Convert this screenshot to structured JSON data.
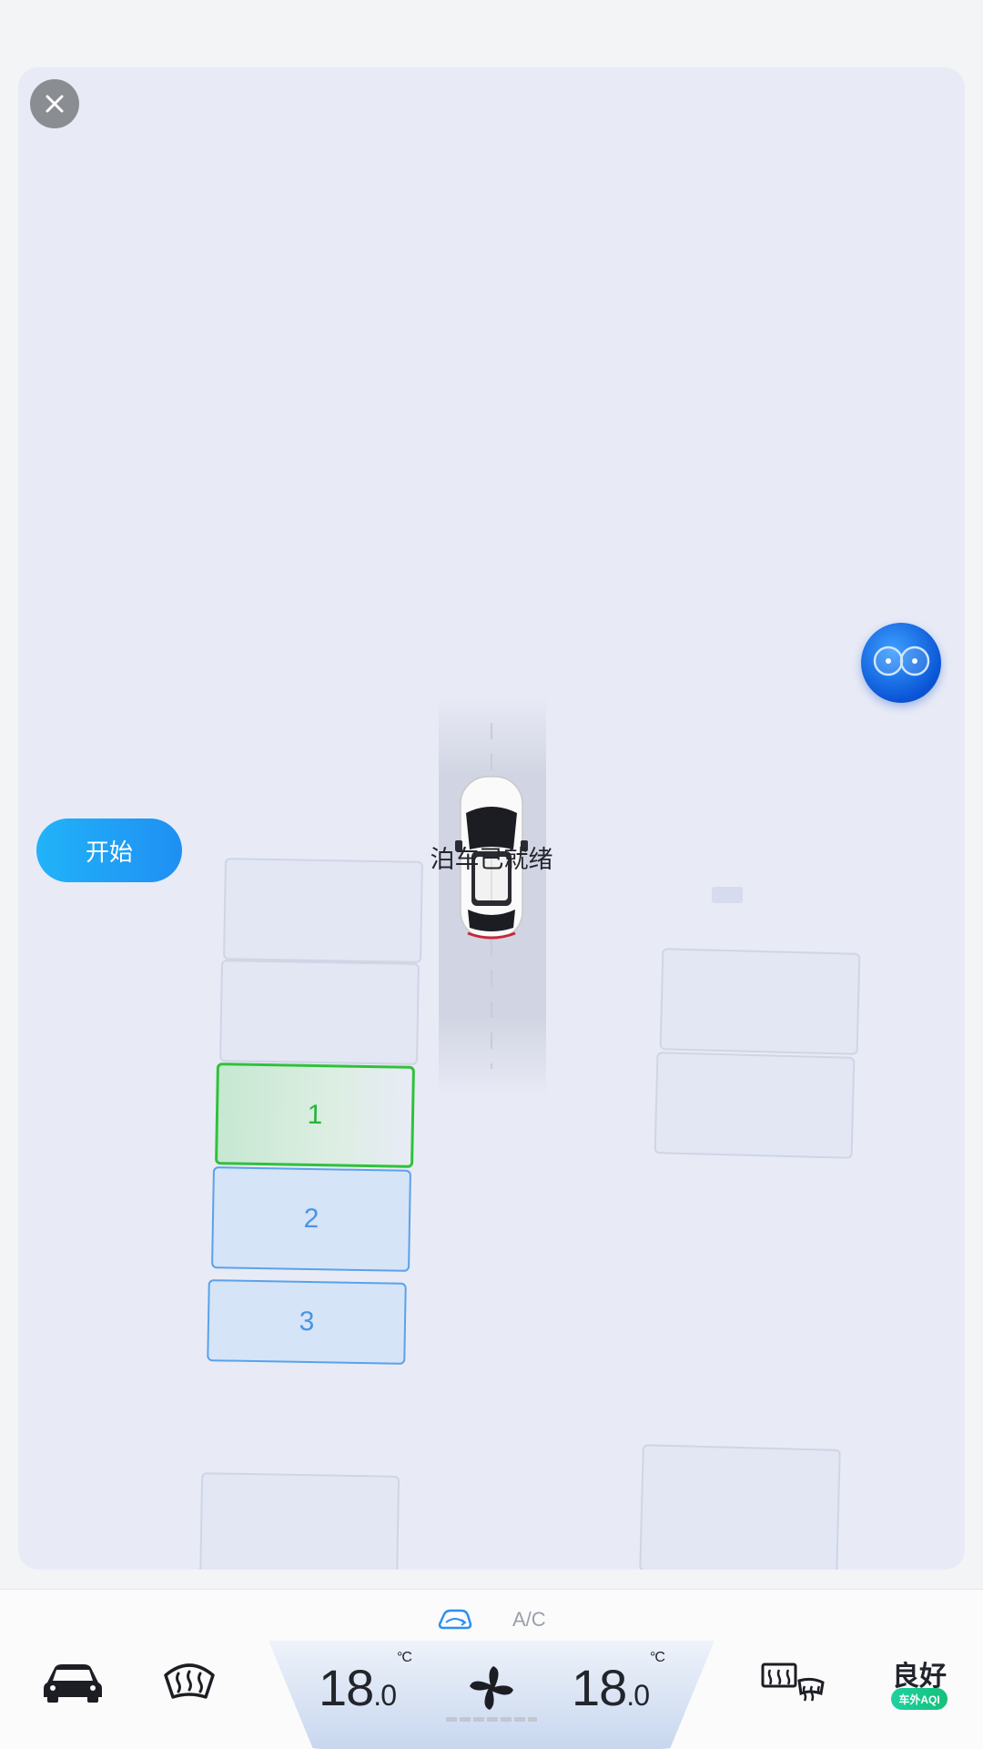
{
  "parking": {
    "status_text": "泊车已就绪",
    "start_label": "开始",
    "slots": [
      {
        "label": "1",
        "state": "selected"
      },
      {
        "label": "2",
        "state": "available"
      },
      {
        "label": "3",
        "state": "available"
      }
    ]
  },
  "climate": {
    "ac_label": "A/C",
    "left_temp_int": "18",
    "left_temp_dec": ".0",
    "right_temp_int": "18",
    "right_temp_dec": ".0",
    "unit": "°C"
  },
  "air_quality": {
    "status": "良好",
    "badge": "车外AQI"
  },
  "colors": {
    "accent_blue": "#1f8ff3",
    "selected_green": "#2fc23a",
    "slot_blue": "#5aa2ea"
  },
  "icons": [
    "close-icon",
    "car-icon",
    "front-defrost-icon",
    "ac-recirculation-icon",
    "fan-icon",
    "rear-defrost-icon",
    "assistant-icon"
  ]
}
